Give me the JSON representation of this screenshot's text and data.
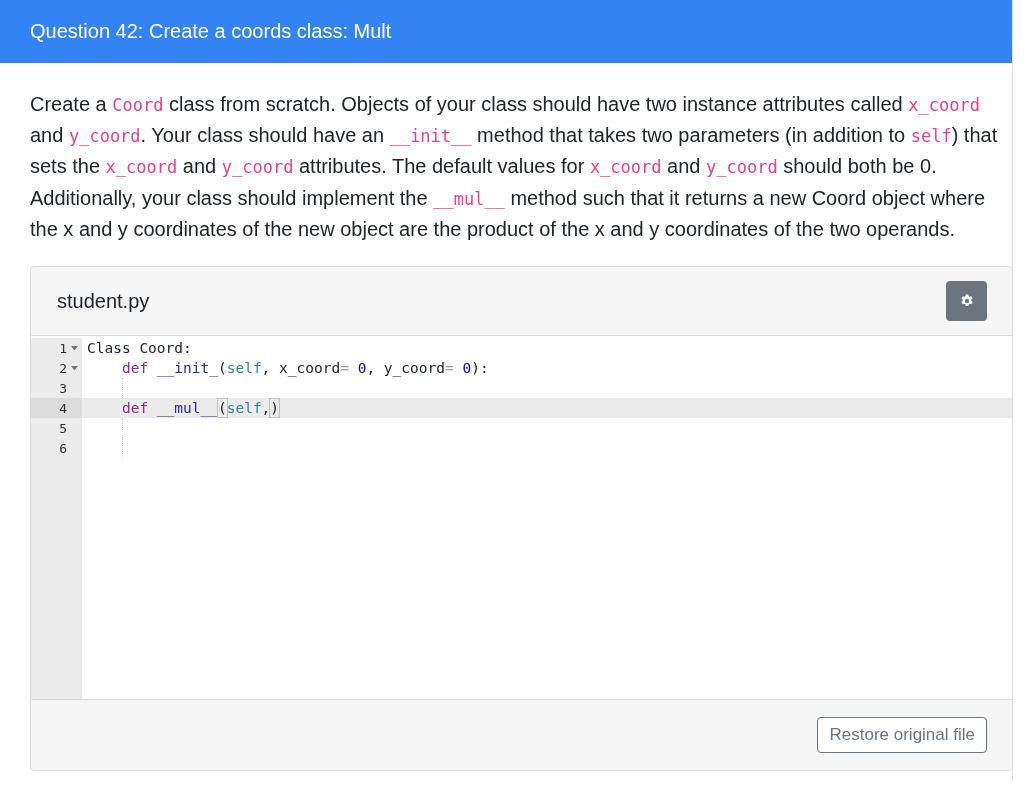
{
  "header": {
    "title": "Question 42: Create a coords class: Mult"
  },
  "prompt": [
    {
      "kind": "text",
      "text": "Create a "
    },
    {
      "kind": "code",
      "text": "Coord"
    },
    {
      "kind": "text",
      "text": " class from scratch. Objects of your class should have two instance attributes called "
    },
    {
      "kind": "code",
      "text": "x_coord"
    },
    {
      "kind": "text",
      "text": " and "
    },
    {
      "kind": "code",
      "text": "y_coord"
    },
    {
      "kind": "text",
      "text": ". Your class should have an "
    },
    {
      "kind": "code",
      "text": "__init__"
    },
    {
      "kind": "text",
      "text": " method that takes two parameters (in addition to "
    },
    {
      "kind": "code",
      "text": "self"
    },
    {
      "kind": "text",
      "text": ") that sets the "
    },
    {
      "kind": "code",
      "text": "x_coord"
    },
    {
      "kind": "text",
      "text": " and "
    },
    {
      "kind": "code",
      "text": "y_coord"
    },
    {
      "kind": "text",
      "text": " attributes. The default values for "
    },
    {
      "kind": "code",
      "text": "x_coord"
    },
    {
      "kind": "text",
      "text": " and "
    },
    {
      "kind": "code",
      "text": "y_coord"
    },
    {
      "kind": "text",
      "text": " should both be 0. Additionally, your class should implement the "
    },
    {
      "kind": "code",
      "text": "__mul__"
    },
    {
      "kind": "text",
      "text": " method such that it returns a new Coord object where the x and y coordinates of the new object are the product of the x and y coordinates of the two operands."
    }
  ],
  "editor": {
    "filename": "student.py",
    "lines": [
      {
        "number": "1",
        "foldable": true,
        "active": false,
        "indent_guide": false,
        "tokens": [
          {
            "kind": "plain",
            "text": "Class Coord:"
          }
        ]
      },
      {
        "number": "2",
        "foldable": true,
        "active": false,
        "indent_guide": false,
        "tokens": [
          {
            "kind": "keyword",
            "text": "    def"
          },
          {
            "kind": "name",
            "text": " __init_"
          },
          {
            "kind": "plain",
            "text": "("
          },
          {
            "kind": "self",
            "text": "self"
          },
          {
            "kind": "plain",
            "text": ", x_coord"
          },
          {
            "kind": "operator",
            "text": "="
          },
          {
            "kind": "number",
            "text": " 0"
          },
          {
            "kind": "plain",
            "text": ", y_coord"
          },
          {
            "kind": "operator",
            "text": "="
          },
          {
            "kind": "number",
            "text": " 0"
          },
          {
            "kind": "plain",
            "text": "):"
          }
        ]
      },
      {
        "number": "3",
        "foldable": false,
        "active": false,
        "indent_guide": true
      },
      {
        "number": "4",
        "foldable": false,
        "active": true,
        "indent_guide": false,
        "tokens": [
          {
            "kind": "keyword",
            "text": "    def"
          },
          {
            "kind": "name",
            "text": " __mul__"
          },
          {
            "kind": "bracket",
            "text": "("
          },
          {
            "kind": "self",
            "text": "self"
          },
          {
            "kind": "plain",
            "text": ","
          },
          {
            "kind": "bracket",
            "text": ")"
          }
        ]
      },
      {
        "number": "5",
        "foldable": false,
        "active": false,
        "indent_guide": true
      },
      {
        "number": "6",
        "foldable": false,
        "active": false,
        "indent_guide": true
      }
    ]
  },
  "footer": {
    "restore_button": "Restore original file"
  }
}
